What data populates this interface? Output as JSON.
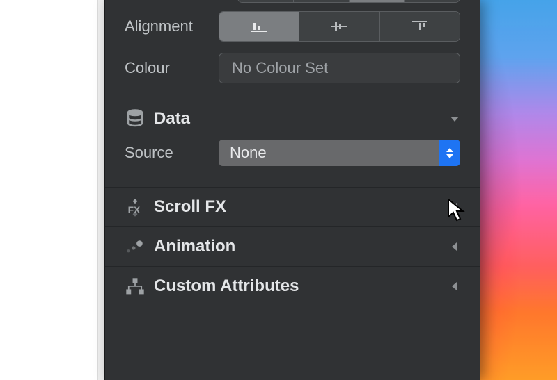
{
  "properties": {
    "alignment": {
      "label": "Alignment"
    },
    "colour": {
      "label": "Colour",
      "placeholder": "No Colour Set"
    }
  },
  "sections": {
    "data": {
      "title": "Data",
      "source_label": "Source",
      "source_value": "None"
    },
    "scroll_fx": {
      "title": "Scroll FX"
    },
    "animation": {
      "title": "Animation"
    },
    "custom_attributes": {
      "title": "Custom Attributes"
    }
  }
}
